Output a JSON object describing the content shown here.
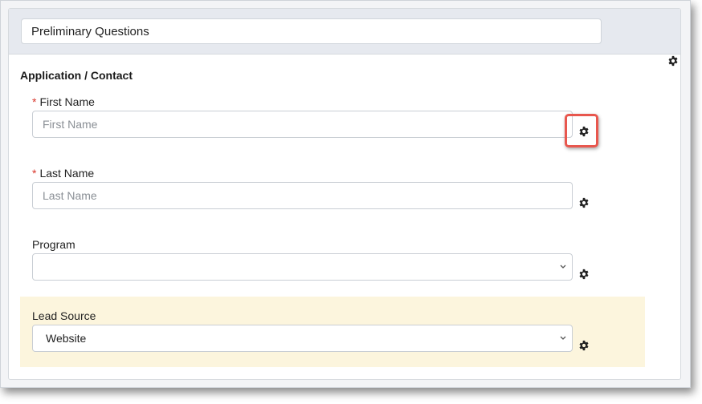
{
  "header": {
    "title_value": "Preliminary Questions"
  },
  "section": {
    "title": "Application / Contact",
    "gear_icon": "gear-icon"
  },
  "fields": [
    {
      "label": "First Name",
      "required": true,
      "type": "text",
      "placeholder": "First Name",
      "value": ""
    },
    {
      "label": "Last Name",
      "required": true,
      "type": "text",
      "placeholder": "Last Name",
      "value": ""
    },
    {
      "label": "Program",
      "required": false,
      "type": "select",
      "value": ""
    },
    {
      "label": "Lead Source",
      "required": false,
      "type": "select",
      "value": "Website"
    }
  ],
  "required_marker": "*",
  "icons": {
    "gear": "gear-icon",
    "chevron": "chevron-down-icon"
  },
  "colors": {
    "highlight": "#e8574e",
    "required": "#d9362b",
    "lead_panel_bg": "#fcf5dd"
  }
}
